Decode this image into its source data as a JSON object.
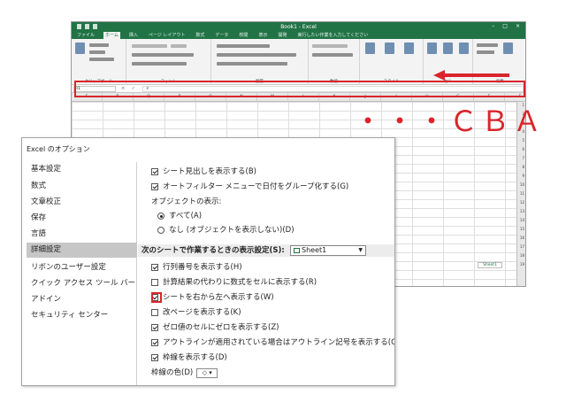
{
  "excel": {
    "title": "Book1 - Excel",
    "tabs": [
      "ファイル",
      "ホーム",
      "挿入",
      "ページ レイアウト",
      "数式",
      "データ",
      "校閲",
      "表示",
      "開発",
      "実行したい作業を入力してください"
    ],
    "active_tab": "ホーム",
    "ribbon_groups": [
      "クリップボード",
      "フォント",
      "配置",
      "数値",
      "スタイル",
      "セル",
      "編集"
    ],
    "namebox": "R1",
    "fx": "× ✓ fx",
    "columns": [
      "S",
      "R",
      "Q",
      "P",
      "O",
      "N",
      "M",
      "L",
      "K",
      "J",
      "I",
      "H",
      "G",
      "F",
      "E",
      "D",
      "C",
      "B",
      "A"
    ],
    "rows": [
      "1",
      "2",
      "3",
      "4",
      "5",
      "6",
      "7",
      "8",
      "9",
      "10",
      "11",
      "12",
      "13",
      "14",
      "15",
      "16",
      "17",
      "18",
      "19"
    ],
    "sheet_tab": "Sheet1"
  },
  "annotation": {
    "text": "・・・ＣＢＡ",
    "color": "#d9252b"
  },
  "dialog": {
    "title": "Excel のオプション",
    "nav": [
      "基本設定",
      "数式",
      "文章校正",
      "保存",
      "言語",
      "詳細設定",
      "リボンのユーザー設定",
      "クイック アクセス ツール バー",
      "アドイン",
      "セキュリティ センター"
    ],
    "selected_nav": "詳細設定",
    "options": {
      "show_sheet_tabs": "シート見出しを表示する(B)",
      "autofilter_group_dates": "オートフィルター メニューで日付をグループ化する(G)",
      "objects_label": "オブジェクトの表示:",
      "all": "すべて(A)",
      "none": "なし (オブジェクトを表示しない)(D)",
      "section_label": "次のシートで作業するときの表示設定(S):",
      "sheet_select": "Sheet1",
      "row_col_headers": "行列番号を表示する(H)",
      "show_formulas": "計算結果の代わりに数式をセルに表示する(R)",
      "right_to_left": "シートを右から左へ表示する(W)",
      "page_breaks": "改ページを表示する(K)",
      "show_zeros": "ゼロ値のセルにゼロを表示する(Z)",
      "outline_symbols": "アウトラインが適用されている場合はアウトライン記号を表示する(O)",
      "gridlines": "枠線を表示する(D)",
      "gridline_color": "枠線の色(D)"
    }
  }
}
